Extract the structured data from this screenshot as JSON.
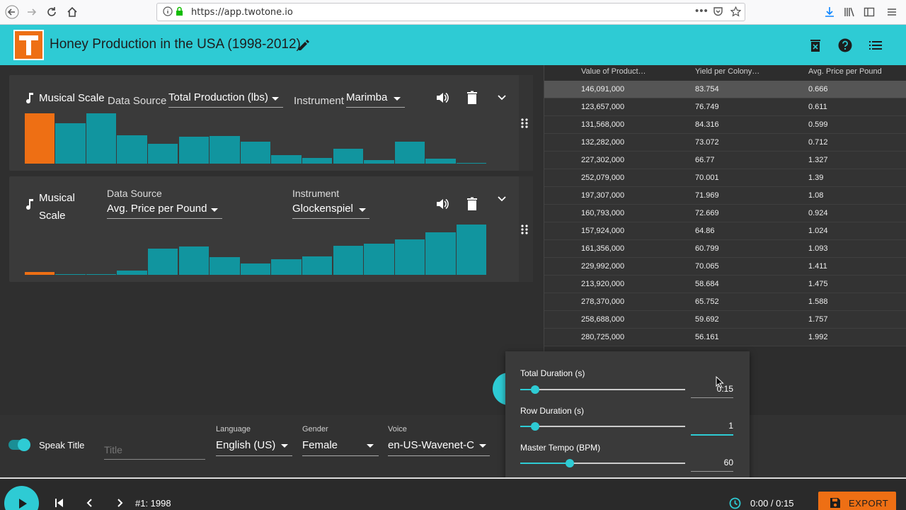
{
  "browser": {
    "url": "https://app.twotone.io"
  },
  "app": {
    "title": "Honey Production in the USA (1998-2012)",
    "accent_color": "#2ecbd4",
    "brand_color": "#ee6f14"
  },
  "tracks": [
    {
      "type_label": "Musical Scale",
      "data_source_label": "Data Source",
      "data_source": "Total Production (lbs)",
      "instrument_label": "Instrument",
      "instrument": "Marimba",
      "bar_values": [
        1.0,
        0.8,
        1.0,
        0.57,
        0.39,
        0.53,
        0.55,
        0.43,
        0.17,
        0.11,
        0.29,
        0.07,
        0.44,
        0.1,
        0.01
      ],
      "highlighted_index": 0
    },
    {
      "type_label": "Musical Scale",
      "data_source_label": "Data Source",
      "data_source": "Avg. Price per Pound",
      "instrument_label": "Instrument",
      "instrument": "Glockenspiel",
      "bar_values": [
        0.05,
        0.02,
        0.01,
        0.08,
        0.52,
        0.56,
        0.35,
        0.23,
        0.31,
        0.36,
        0.58,
        0.62,
        0.71,
        0.84,
        1.0
      ],
      "highlighted_index": 0
    }
  ],
  "table": {
    "columns": [
      "Value of Product…",
      "Yield per Colony…",
      "Avg. Price per Pound"
    ],
    "rows": [
      [
        "146,091,000",
        "83.754",
        "0.666"
      ],
      [
        "123,657,000",
        "76.749",
        "0.611"
      ],
      [
        "131,568,000",
        "84.316",
        "0.599"
      ],
      [
        "132,282,000",
        "73.072",
        "0.712"
      ],
      [
        "227,302,000",
        "66.77",
        "1.327"
      ],
      [
        "252,079,000",
        "70.001",
        "1.39"
      ],
      [
        "197,307,000",
        "71.969",
        "1.08"
      ],
      [
        "160,793,000",
        "72.669",
        "0.924"
      ],
      [
        "157,924,000",
        "64.86",
        "1.024"
      ],
      [
        "161,356,000",
        "60.799",
        "1.093"
      ],
      [
        "229,992,000",
        "70.065",
        "1.411"
      ],
      [
        "213,920,000",
        "58.684",
        "1.475"
      ],
      [
        "278,370,000",
        "65.752",
        "1.588"
      ],
      [
        "258,688,000",
        "59.692",
        "1.757"
      ],
      [
        "280,725,000",
        "56.161",
        "1.992"
      ]
    ],
    "selected_row": 0
  },
  "speech": {
    "speak_title_label": "Speak Title",
    "speak_title_on": true,
    "title_placeholder": "Title",
    "language_label": "Language",
    "language": "English (US)",
    "gender_label": "Gender",
    "gender": "Female",
    "voice_label": "Voice",
    "voice": "en-US-Wavenet-C"
  },
  "timing": {
    "total_duration_label": "Total Duration (s)",
    "total_duration": "0:15",
    "total_duration_level": 0.09,
    "row_duration_label": "Row Duration (s)",
    "row_duration": "1",
    "row_duration_level": 0.09,
    "tempo_label": "Master Tempo (BPM)",
    "tempo": "60",
    "tempo_level": 0.3
  },
  "player": {
    "position": "#1: 1998",
    "time": "0:00 / 0:15",
    "export_label": "EXPORT"
  }
}
